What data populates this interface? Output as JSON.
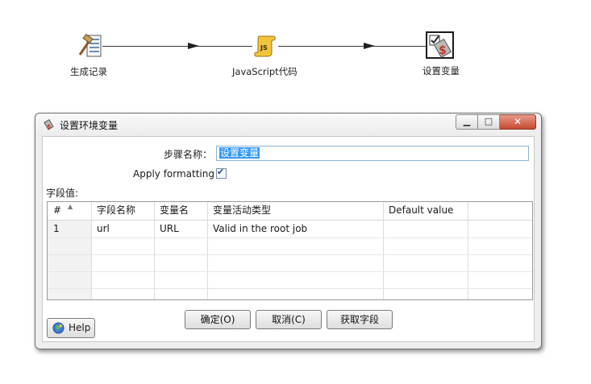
{
  "canvas": {
    "steps": [
      {
        "label": "生成记录",
        "icon": "row-generator-icon"
      },
      {
        "label": "JavaScript代码",
        "icon": "javascript-scroll-icon"
      },
      {
        "label": "设置变量",
        "icon": "set-variables-icon"
      }
    ]
  },
  "dialog": {
    "title": "设置环境变量",
    "title_icon": "set-variables-icon",
    "window_buttons": {
      "minimize": "minimize-icon",
      "maximize": "maximize-icon",
      "close": "close-icon"
    },
    "step_name_label": "步骤名称：",
    "step_name_value": "设置变量",
    "apply_formatting_label": "Apply formatting",
    "apply_formatting_checked": true,
    "fields_label": "字段值:",
    "table": {
      "columns": [
        "#",
        "字段名称",
        "变量名",
        "变量活动类型",
        "Default value"
      ],
      "rows": [
        [
          "1",
          "url",
          "URL",
          "Valid in the root job",
          ""
        ]
      ]
    },
    "buttons": {
      "ok": "确定(O)",
      "cancel": "取消(C)",
      "get_fields": "获取字段",
      "help": "Help"
    }
  },
  "colors": {
    "dialog_bg": "#eeeeee",
    "selection": "#3399ff",
    "close_button": "#c6492f"
  }
}
